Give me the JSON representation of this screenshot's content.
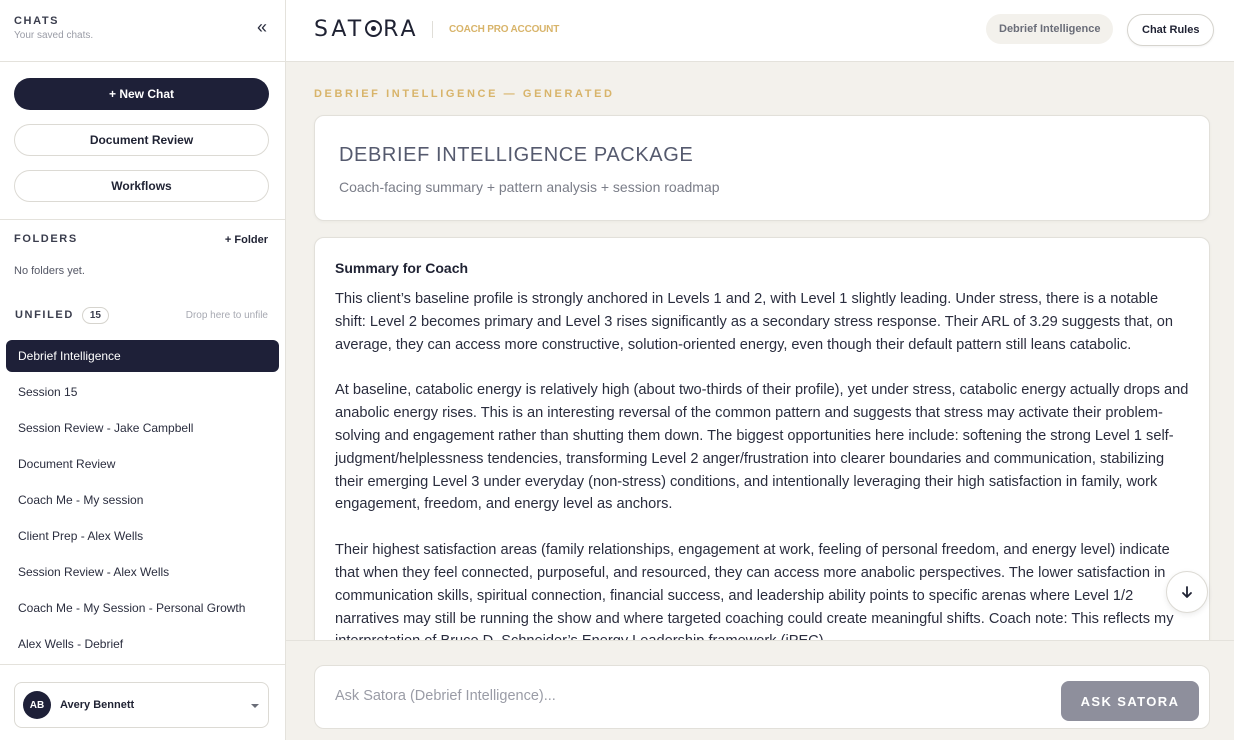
{
  "sidebar": {
    "title": "CHATS",
    "subtitle": "Your saved chats.",
    "collapse_icon": "«",
    "new_chat_label": "+ New Chat",
    "document_review_label": "Document Review",
    "workflows_label": "Workflows",
    "folders_label": "FOLDERS",
    "add_folder_label": "+ Folder",
    "no_folders_text": "No folders yet.",
    "unfiled_label": "UNFILED",
    "unfiled_count": "15",
    "drop_hint": "Drop here to unfile",
    "chats": [
      {
        "label": "Debrief Intelligence",
        "active": true
      },
      {
        "label": "Session 15"
      },
      {
        "label": "Session Review - Jake Campbell"
      },
      {
        "label": "Document Review"
      },
      {
        "label": "Coach Me - My session"
      },
      {
        "label": "Client Prep - Alex Wells"
      },
      {
        "label": "Session Review - Alex Wells"
      },
      {
        "label": "Coach Me - My Session - Personal Growth"
      },
      {
        "label": "Alex Wells - Debrief"
      }
    ],
    "user": {
      "initials": "AB",
      "name": "Avery Bennett"
    }
  },
  "header": {
    "logo_text_pre": "SAT",
    "logo_text_post": "RA",
    "account_label": "COACH PRO ACCOUNT",
    "tag_label": "Debrief Intelligence",
    "chat_rules_label": "Chat Rules"
  },
  "main": {
    "eyebrow": "DEBRIEF INTELLIGENCE — GENERATED",
    "package_title": "DEBRIEF INTELLIGENCE PACKAGE",
    "package_subtitle": "Coach-facing summary + pattern analysis + session roadmap",
    "summary_title": "Summary for Coach",
    "paragraphs": [
      "This client’s baseline profile is strongly anchored in Levels 1 and 2, with Level 1 slightly leading. Under stress, there is a notable shift: Level 2 becomes primary and Level 3 rises significantly as a secondary stress response. Their ARL of 3.29 suggests that, on average, they can access more constructive, solution-oriented energy, even though their default pattern still leans catabolic.",
      "At baseline, catabolic energy is relatively high (about two-thirds of their profile), yet under stress, catabolic energy actually drops and anabolic energy rises. This is an interesting reversal of the common pattern and suggests that stress may activate their problem-solving and engagement rather than shutting them down. The biggest opportunities here include: softening the strong Level 1 self-judgment/helplessness tendencies, transforming Level 2 anger/frustration into clearer boundaries and communication, stabilizing their emerging Level 3 under everyday (non-stress) conditions, and intentionally leveraging their high satisfaction in family, work engagement, freedom, and energy level as anchors.",
      "Their highest satisfaction areas (family relationships, engagement at work, feeling of personal freedom, and energy level) indicate that when they feel connected, purposeful, and resourced, they can access more anabolic perspectives. The lower satisfaction in communication skills, spiritual connection, financial success, and leadership ability points to specific arenas where Level 1/2 narratives may still be running the show and where targeted coaching could create meaningful shifts. Coach note: This reflects my interpretation of Bruce D. Schneider’s Energy Leadership framework (iPEC)."
    ]
  },
  "input": {
    "placeholder": "Ask Satora (Debrief Intelligence)...",
    "ask_label": "ASK SATORA"
  },
  "colors": {
    "accent_gold": "#d8b46a",
    "dark_navy": "#1e2038",
    "background": "#f3f1ec",
    "button_gray": "#8e8f9c"
  },
  "icons": {
    "collapse": "collapse-sidebar-icon",
    "scroll_down": "arrow-down-icon",
    "user_menu": "caret-down-icon"
  }
}
